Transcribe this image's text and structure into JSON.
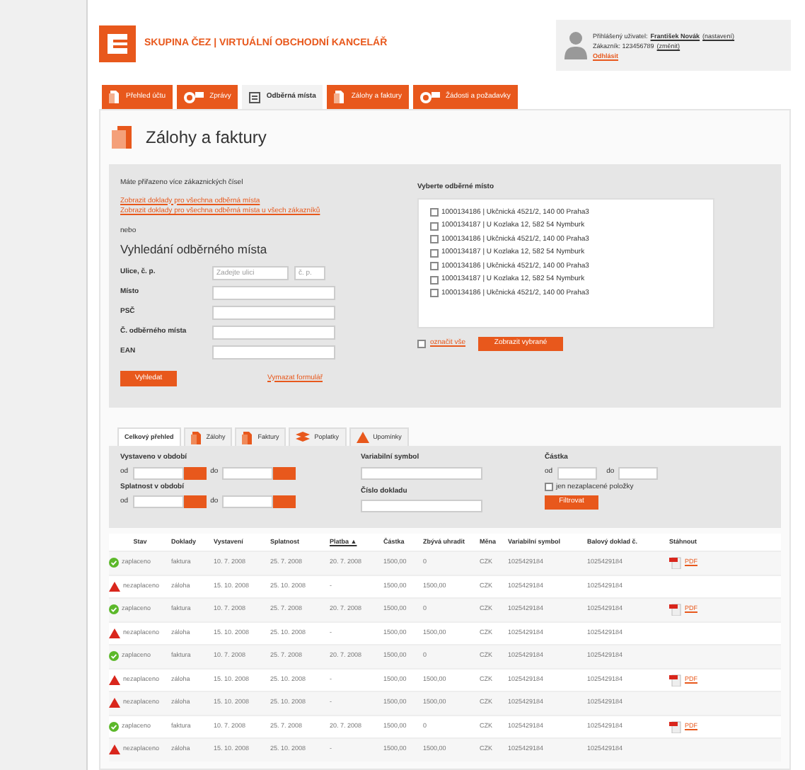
{
  "brand": {
    "title": "SKUPINA ČEZ | VIRTUÁLNÍ OBCHODNÍ KANCELÁŘ"
  },
  "user": {
    "label": "Přihlášený uživatel:",
    "name": "František Novák",
    "settings": "(nastavení)",
    "customer": "Zákazník: 123456789",
    "change": "(změnit)",
    "logout": "Odhlásit"
  },
  "nav_tabs": [
    {
      "label": "Přehled účtu",
      "kind": "doc",
      "selected": false
    },
    {
      "label": "Zprávy",
      "kind": "mail",
      "selected": false
    },
    {
      "label": "Odběrná místa",
      "kind": "list",
      "selected": true
    },
    {
      "label": "Zálohy a faktury",
      "kind": "doc",
      "selected": false
    },
    {
      "label": "Žádosti a požadavky",
      "kind": "mail",
      "selected": false
    }
  ],
  "page_title": "Zálohy a faktury",
  "search": {
    "note": "Máte přiřazeno více zákaznických čísel",
    "links": [
      "Zobrazit doklady pro všechna odběrná místa",
      "Zobrazit doklady pro všechna odběrná místa u všech zákazníků"
    ],
    "or": "nebo",
    "heading": "Vyhledání odběrného místa",
    "street_label": "Ulice, č. p.",
    "street_placeholder": "Zadejte ulici",
    "number_placeholder": "č. p.",
    "fields": [
      "Místo",
      "PSČ",
      "Č. odběrného místa",
      "EAN"
    ],
    "button": "Vyhledat",
    "clear": "Vymazat formulář"
  },
  "places": {
    "title": "Vyberte odběrné místo",
    "items": [
      {
        "label": "1000134186 | Ukčnická 4521/2, 140 00 Praha3",
        "checked": false
      },
      {
        "label": "1000134187 | U Kozlaka 12, 582 54 Nymburk",
        "checked": false
      },
      {
        "label": "1000134186 | Ukčnická 4521/2, 140 00 Praha3",
        "checked": false
      },
      {
        "label": "1000134187 | U Kozlaka 12, 582 54 Nymburk",
        "checked": false
      },
      {
        "label": "1000134186 | Ukčnická 4521/2, 140 00 Praha3",
        "checked": false
      },
      {
        "label": "1000134187 | U Kozlaka 12, 582 54 Nymburk",
        "checked": false
      },
      {
        "label": "1000134186 | Ukčnická 4521/2, 140 00 Praha3",
        "checked": false
      }
    ],
    "select_all": {
      "label": "označit vše",
      "checked": false
    },
    "button": "Zobrazit vybrané"
  },
  "doc_tabs": [
    {
      "label": "Celkový přehled",
      "kind": "plain",
      "selected": true
    },
    {
      "label": "Zálohy",
      "kind": "doc",
      "selected": false
    },
    {
      "label": "Faktury",
      "kind": "doc",
      "selected": false
    },
    {
      "label": "Poplatky",
      "kind": "stack",
      "selected": false
    },
    {
      "label": "Upomínky",
      "kind": "warn",
      "selected": false
    }
  ],
  "filters": {
    "issued": {
      "label": "Vystaveno v období",
      "from": "od",
      "to": "do"
    },
    "due": {
      "label": "Splatnost v období",
      "from": "od",
      "to": "do"
    },
    "variable_symbol": "Variabilní symbol",
    "doc_number": "Číslo dokladu",
    "amount": {
      "label": "Částka",
      "from": "od",
      "to": "do"
    },
    "unpaid_only": {
      "label": "jen nezaplacené položky",
      "checked": false
    },
    "button": "Filtrovat"
  },
  "table": {
    "columns": [
      "Stav",
      "Doklady",
      "Vystavení",
      "Splatnost",
      "Platba ▲",
      "Částka",
      "Zbývá uhradit",
      "Měna",
      "Variabilní symbol",
      "Balový doklad č.",
      "Stáhnout"
    ],
    "rows": [
      {
        "kind": "paid",
        "cells": [
          "zaplaceno",
          "faktura",
          "10. 7. 2008",
          "25. 7. 2008",
          "20. 7. 2008",
          "1500,00",
          "0",
          "CZK",
          "1025429184",
          "1025429184"
        ],
        "pdf": "PDF"
      },
      {
        "kind": "unpaid",
        "cells": [
          "nezaplaceno",
          "záloha",
          "15. 10. 2008",
          "25. 10. 2008",
          "-",
          "1500,00",
          "1500,00",
          "CZK",
          "1025429184",
          "1025429184"
        ]
      },
      {
        "kind": "paid",
        "cells": [
          "zaplaceno",
          "faktura",
          "10. 7. 2008",
          "25. 7. 2008",
          "20. 7. 2008",
          "1500,00",
          "0",
          "CZK",
          "1025429184",
          "1025429184"
        ],
        "pdf": "PDF"
      },
      {
        "kind": "unpaid",
        "cells": [
          "nezaplaceno",
          "záloha",
          "15. 10. 2008",
          "25. 10. 2008",
          "-",
          "1500,00",
          "1500,00",
          "CZK",
          "1025429184",
          "1025429184"
        ]
      },
      {
        "kind": "paid",
        "cells": [
          "zaplaceno",
          "faktura",
          "10. 7. 2008",
          "25. 7. 2008",
          "20. 7. 2008",
          "1500,00",
          "0",
          "CZK",
          "1025429184",
          "1025429184"
        ]
      },
      {
        "kind": "unpaid",
        "cells": [
          "nezaplaceno",
          "záloha",
          "15. 10. 2008",
          "25. 10. 2008",
          "-",
          "1500,00",
          "1500,00",
          "CZK",
          "1025429184",
          "1025429184"
        ],
        "pdf": "PDF"
      },
      {
        "kind": "unpaid",
        "cells": [
          "nezaplaceno",
          "záloha",
          "15. 10. 2008",
          "25. 10. 2008",
          "-",
          "1500,00",
          "1500,00",
          "CZK",
          "1025429184",
          "1025429184"
        ]
      },
      {
        "kind": "paid",
        "cells": [
          "zaplaceno",
          "faktura",
          "10. 7. 2008",
          "25. 7. 2008",
          "20. 7. 2008",
          "1500,00",
          "0",
          "CZK",
          "1025429184",
          "1025429184"
        ],
        "pdf": "PDF"
      },
      {
        "kind": "unpaid",
        "cells": [
          "nezaplaceno",
          "záloha",
          "15. 10. 2008",
          "25. 10. 2008",
          "-",
          "1500,00",
          "1500,00",
          "CZK",
          "1025429184",
          "1025429184"
        ]
      }
    ]
  }
}
